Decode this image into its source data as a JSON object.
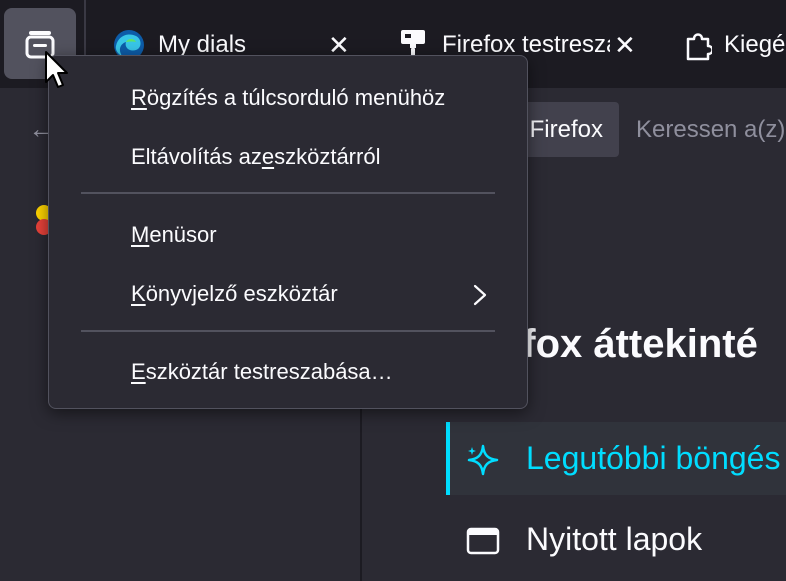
{
  "tabs": [
    {
      "title": "My dials",
      "close": "✕",
      "icon": "edge-swirl-icon"
    },
    {
      "title": "Firefox testresza",
      "close": "✕",
      "icon": "paint-roller-icon"
    },
    {
      "title": "Kiegés",
      "icon": "puzzle-icon"
    }
  ],
  "toolbar": {
    "back": "←",
    "urlbar_chip": "Firefox",
    "urlbar_placeholder": "Keressen a(z)"
  },
  "page": {
    "heading": "efox áttekinté",
    "nav": [
      {
        "label": "Legutóbbi böngés",
        "icon": "sparkle-icon",
        "active": true
      },
      {
        "label": "Nyitott lapok",
        "icon": "window-icon",
        "active": false
      }
    ]
  },
  "menu": {
    "items": [
      {
        "pre": "",
        "key": "R",
        "post": "ögzítés a túlcsorduló menühöz"
      },
      {
        "pre": "Eltávolítás az ",
        "key": "e",
        "post": "szköztárról"
      },
      {
        "pre": "",
        "key": "M",
        "post": "enüsor"
      },
      {
        "pre": "",
        "key": "K",
        "post": "önyvjelző eszköztár"
      },
      {
        "pre": "",
        "key": "E",
        "post": "szköztár testreszabása…"
      }
    ]
  },
  "colors": {
    "accent": "#00ddff",
    "menu_bg": "#2b2a33",
    "tabstrip_bg": "#1c1b22"
  }
}
